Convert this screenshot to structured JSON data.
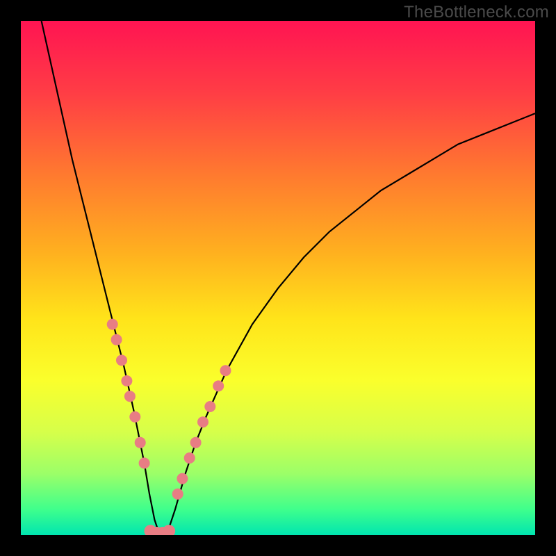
{
  "watermark": "TheBottleneck.com",
  "chart_data": {
    "type": "line",
    "title": "",
    "xlabel": "",
    "ylabel": "",
    "xlim": [
      0,
      100
    ],
    "ylim": [
      0,
      100
    ],
    "note": "V-shaped bottleneck curve on a vertical traffic-light gradient (red=high bottleneck at top, green=no bottleneck at bottom). Axes are unlabeled. Curve minimum near x≈27. Pink dots highlight near-bottom segments of both branches.",
    "series": [
      {
        "name": "bottleneck-curve",
        "x": [
          4,
          6,
          8,
          10,
          12,
          14,
          16,
          18,
          20,
          22,
          24,
          25,
          26,
          27,
          28,
          29,
          30,
          32,
          34,
          36,
          40,
          45,
          50,
          55,
          60,
          65,
          70,
          75,
          80,
          85,
          90,
          95,
          100
        ],
        "y": [
          100,
          91,
          82,
          73,
          65,
          57,
          49,
          41,
          33,
          24,
          14,
          8,
          3,
          0,
          0,
          2,
          5,
          12,
          18,
          23,
          32,
          41,
          48,
          54,
          59,
          63,
          67,
          70,
          73,
          76,
          78,
          80,
          82
        ]
      }
    ],
    "highlight_points_left": [
      {
        "x": 17.8,
        "y": 41
      },
      {
        "x": 18.6,
        "y": 38
      },
      {
        "x": 19.6,
        "y": 34
      },
      {
        "x": 20.6,
        "y": 30
      },
      {
        "x": 21.2,
        "y": 27
      },
      {
        "x": 22.2,
        "y": 23
      },
      {
        "x": 23.2,
        "y": 18
      },
      {
        "x": 24.0,
        "y": 14
      }
    ],
    "highlight_points_right": [
      {
        "x": 30.5,
        "y": 8
      },
      {
        "x": 31.4,
        "y": 11
      },
      {
        "x": 32.8,
        "y": 15
      },
      {
        "x": 34.0,
        "y": 18
      },
      {
        "x": 35.4,
        "y": 22
      },
      {
        "x": 36.8,
        "y": 25
      },
      {
        "x": 38.4,
        "y": 29
      },
      {
        "x": 39.8,
        "y": 32
      }
    ],
    "highlight_points_bottom": [
      {
        "x": 25.2,
        "y": 0.8
      },
      {
        "x": 26.4,
        "y": 0.4
      },
      {
        "x": 27.6,
        "y": 0.4
      },
      {
        "x": 28.8,
        "y": 0.8
      }
    ],
    "colors": {
      "curve": "#000000",
      "dots": "#e87d84",
      "gradient_top": "#ff1452",
      "gradient_bottom": "#00e5b0"
    }
  }
}
